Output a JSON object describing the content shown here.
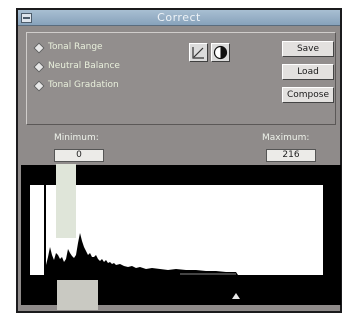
{
  "window": {
    "title": "Correct"
  },
  "options": [
    {
      "label": "Tonal Range"
    },
    {
      "label": "Neutral Balance"
    },
    {
      "label": "Tonal Gradation"
    }
  ],
  "icons": {
    "curve_tool": "curve-icon",
    "contrast_tool": "contrast-icon"
  },
  "buttons": {
    "save": "Save",
    "load": "Load",
    "compose": "Compose"
  },
  "range": {
    "min_label": "Minimum:",
    "min_value": "0",
    "max_label": "Maximum:",
    "max_value": "216"
  },
  "colors": {
    "window_bg": "#8f8b8a",
    "titlebar": "#9bb3c9",
    "histogram_bg": "#ffffff",
    "histogram_fg": "#000000"
  }
}
